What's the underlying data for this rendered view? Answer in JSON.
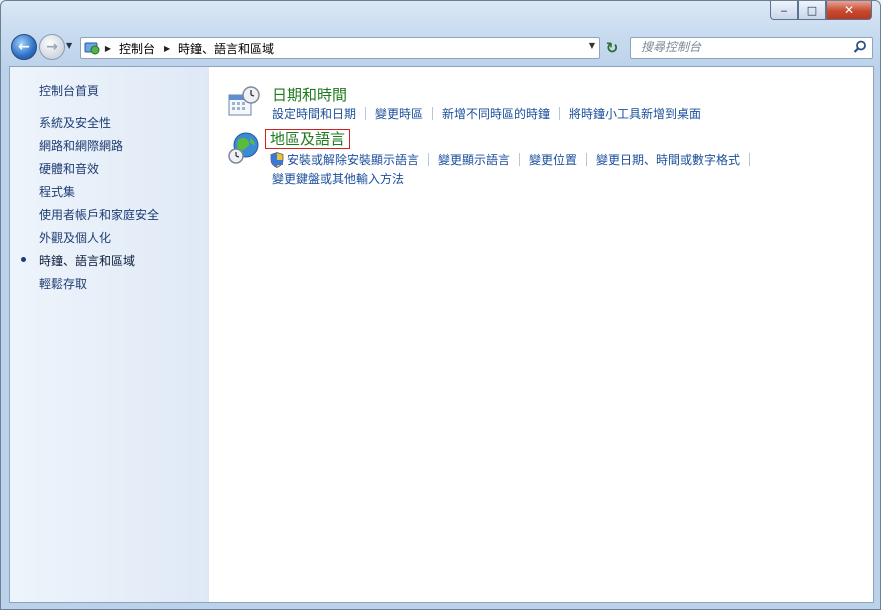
{
  "window": {
    "minimize_glyph": "‒",
    "maximize_glyph": "□",
    "close_glyph": "✕"
  },
  "nav": {
    "back_glyph": "←",
    "forward_glyph": "→",
    "recent_glyph": "▼",
    "breadcrumb": [
      "控制台",
      "時鐘、語言和區域"
    ],
    "crumb_sep_glyph": "▶",
    "dropdown_glyph": "▼",
    "refresh_glyph": "↻",
    "search_placeholder": "搜尋控制台"
  },
  "sidebar": {
    "home": "控制台首頁",
    "items": [
      {
        "label": "系統及安全性",
        "current": false
      },
      {
        "label": "網路和網際網路",
        "current": false
      },
      {
        "label": "硬體和音效",
        "current": false
      },
      {
        "label": "程式集",
        "current": false
      },
      {
        "label": "使用者帳戶和家庭安全",
        "current": false
      },
      {
        "label": "外觀及個人化",
        "current": false
      },
      {
        "label": "時鐘、語言和區域",
        "current": true
      },
      {
        "label": "輕鬆存取",
        "current": false
      }
    ]
  },
  "categories": [
    {
      "title": "日期和時間",
      "tasks": [
        "設定時間和日期",
        "變更時區",
        "新增不同時區的時鐘",
        "將時鐘小工具新增到桌面"
      ]
    },
    {
      "title": "地區及語言",
      "tasks_line1": [
        "安裝或解除安裝顯示語言",
        "變更顯示語言",
        "變更位置",
        "變更日期、時間或數字格式"
      ],
      "tasks_line2": [
        "變更鍵盤或其他輸入方法"
      ]
    }
  ],
  "icons": {
    "calendar_clock": "calendar-clock-icon",
    "globe_clock": "globe-clock-icon",
    "shield": "uac-shield-icon",
    "control_panel": "control-panel-icon",
    "search": "magnifier-icon"
  }
}
